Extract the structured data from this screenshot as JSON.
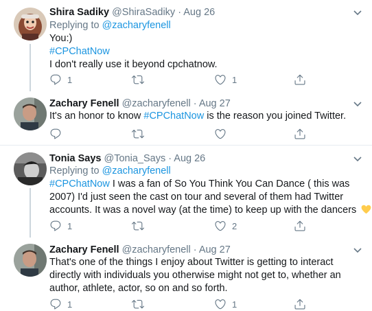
{
  "tweets": [
    {
      "name": "Shira Sadiky",
      "handle": "@ShiraSadiky",
      "date": "· Aug 26",
      "replying_prefix": "Replying to ",
      "replying_to": "@zacharyfenell",
      "lines": [
        {
          "text": "You:)"
        },
        {
          "hashtag": "#CPChatNow"
        },
        {
          "text": "I don't really use it beyond cpchatnow."
        }
      ],
      "reply_count": "1",
      "retweet_count": "",
      "like_count": "1"
    },
    {
      "name": "Zachary Fenell",
      "handle": "@zacharyfenell",
      "date": "· Aug 27",
      "lines": [
        {
          "before": "It's an honor to know ",
          "hashtag": "#CPChatNow",
          "after": " is the reason you joined Twitter."
        }
      ],
      "reply_count": "",
      "retweet_count": "",
      "like_count": ""
    },
    {
      "name": "Tonia Says",
      "handle": "@Tonia_Says",
      "date": "· Aug 26",
      "replying_prefix": "Replying to ",
      "replying_to": "@zacharyfenell",
      "lines": [
        {
          "hashtag": "#CPChatNow",
          "after": " I was a fan of So You Think You Can Dance ( this was"
        },
        {
          "text": "2007) I'd just seen the cast on tour and several of them had Twitter"
        },
        {
          "text": "accounts. It was a novel way (at the time) to keep up with the dancers"
        }
      ],
      "emoji": "yellow-heart",
      "reply_count": "1",
      "retweet_count": "",
      "like_count": "2"
    },
    {
      "name": "Zachary Fenell",
      "handle": "@zacharyfenell",
      "date": "· Aug 27",
      "lines": [
        {
          "text": "That's one of the things I enjoy about Twitter is getting to interact"
        },
        {
          "text": "directly with individuals you otherwise might not get to, whether an"
        },
        {
          "text": "author, athlete, actor, so on and so forth."
        }
      ],
      "reply_count": "1",
      "retweet_count": "",
      "like_count": "1"
    }
  ],
  "icons": {
    "reply": "reply-icon",
    "retweet": "retweet-icon",
    "like": "like-icon",
    "share": "share-icon",
    "caret": "chevron-down-icon"
  },
  "colors": {
    "link": "#1b95e0",
    "secondary": "#657786",
    "thread_line": "#ccd6dd",
    "divider": "#e6ecf0",
    "heart_emoji": "#ffcc4d"
  }
}
